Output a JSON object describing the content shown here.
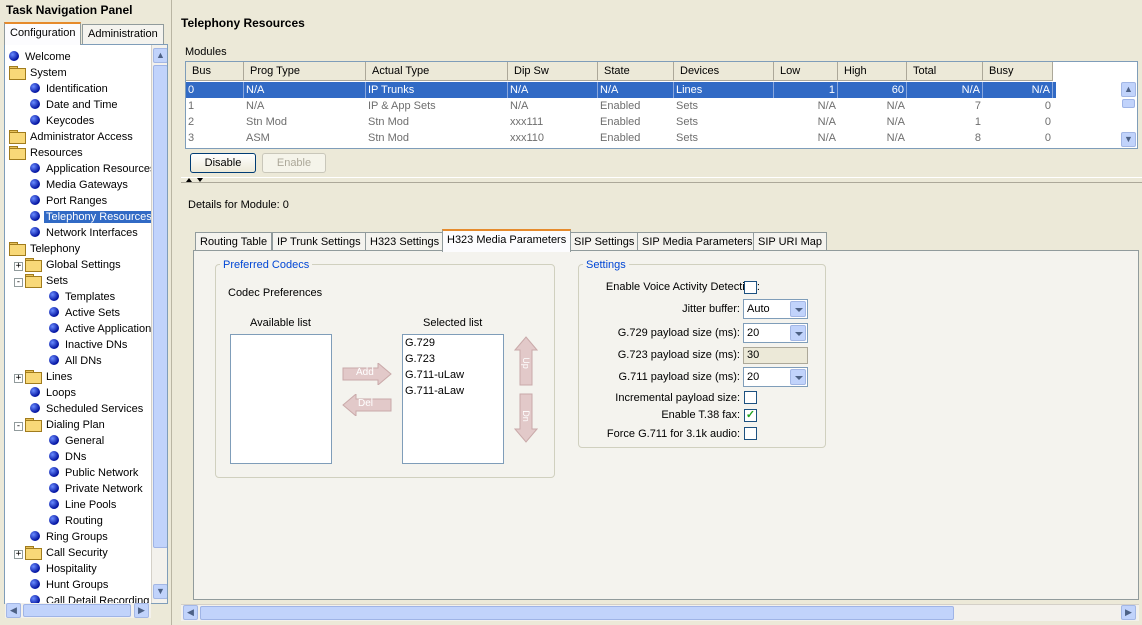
{
  "nav": {
    "title": "Task Navigation Panel",
    "tabs": [
      "Configuration",
      "Administration"
    ],
    "tree": [
      {
        "label": "Welcome",
        "icon": "bullet",
        "indent": 0
      },
      {
        "label": "System",
        "icon": "folder",
        "indent": 0
      },
      {
        "label": "Identification",
        "icon": "bullet",
        "indent": 1
      },
      {
        "label": "Date and Time",
        "icon": "bullet",
        "indent": 1
      },
      {
        "label": "Keycodes",
        "icon": "bullet",
        "indent": 1
      },
      {
        "label": "Administrator Access",
        "icon": "folder",
        "indent": 0
      },
      {
        "label": "Resources",
        "icon": "folder",
        "indent": 0
      },
      {
        "label": "Application Resources",
        "icon": "bullet",
        "indent": 1
      },
      {
        "label": "Media Gateways",
        "icon": "bullet",
        "indent": 1
      },
      {
        "label": "Port Ranges",
        "icon": "bullet",
        "indent": 1
      },
      {
        "label": "Telephony Resources",
        "icon": "bullet",
        "indent": 1,
        "selected": true
      },
      {
        "label": "Network Interfaces",
        "icon": "bullet",
        "indent": 1
      },
      {
        "label": "Telephony",
        "icon": "folder",
        "indent": 0
      },
      {
        "label": "Global Settings",
        "icon": "folder",
        "indent": 1,
        "expander": "+"
      },
      {
        "label": "Sets",
        "icon": "folder",
        "indent": 1,
        "expander": "-"
      },
      {
        "label": "Templates",
        "icon": "bullet",
        "indent": 2
      },
      {
        "label": "Active Sets",
        "icon": "bullet",
        "indent": 2
      },
      {
        "label": "Active Application",
        "icon": "bullet",
        "indent": 2
      },
      {
        "label": "Inactive DNs",
        "icon": "bullet",
        "indent": 2
      },
      {
        "label": "All DNs",
        "icon": "bullet",
        "indent": 2
      },
      {
        "label": "Lines",
        "icon": "folder",
        "indent": 1,
        "expander": "+"
      },
      {
        "label": "Loops",
        "icon": "bullet",
        "indent": 1
      },
      {
        "label": "Scheduled Services",
        "icon": "bullet",
        "indent": 1
      },
      {
        "label": "Dialing Plan",
        "icon": "folder",
        "indent": 1,
        "expander": "-"
      },
      {
        "label": "General",
        "icon": "bullet",
        "indent": 2
      },
      {
        "label": "DNs",
        "icon": "bullet",
        "indent": 2
      },
      {
        "label": "Public Network",
        "icon": "bullet",
        "indent": 2
      },
      {
        "label": "Private Network",
        "icon": "bullet",
        "indent": 2
      },
      {
        "label": "Line Pools",
        "icon": "bullet",
        "indent": 2
      },
      {
        "label": "Routing",
        "icon": "bullet",
        "indent": 2
      },
      {
        "label": "Ring Groups",
        "icon": "bullet",
        "indent": 1
      },
      {
        "label": "Call Security",
        "icon": "folder",
        "indent": 1,
        "expander": "+"
      },
      {
        "label": "Hospitality",
        "icon": "bullet",
        "indent": 1
      },
      {
        "label": "Hunt Groups",
        "icon": "bullet",
        "indent": 1
      },
      {
        "label": "Call Detail Recording",
        "icon": "bullet",
        "indent": 1
      }
    ]
  },
  "main": {
    "title": "Telephony Resources",
    "modules": {
      "label": "Modules",
      "columns": [
        "Bus",
        "Prog Type",
        "Actual Type",
        "Dip Sw",
        "State",
        "Devices",
        "Low",
        "High",
        "Total",
        "Busy"
      ],
      "rows": [
        [
          "0",
          "N/A",
          "IP Trunks",
          "N/A",
          "N/A",
          "Lines",
          "1",
          "60",
          "N/A",
          "N/A"
        ],
        [
          "1",
          "N/A",
          "IP & App Sets",
          "N/A",
          "Enabled",
          "Sets",
          "N/A",
          "N/A",
          "7",
          "0"
        ],
        [
          "2",
          "Stn Mod",
          "Stn Mod",
          "xxx111",
          "Enabled",
          "Sets",
          "N/A",
          "N/A",
          "1",
          "0"
        ],
        [
          "3",
          "ASM",
          "Stn Mod",
          "xxx110",
          "Enabled",
          "Sets",
          "N/A",
          "N/A",
          "8",
          "0"
        ]
      ],
      "buttons": {
        "disable": "Disable",
        "enable": "Enable"
      }
    },
    "details_label": "Details for Module: 0",
    "tabs": [
      "Routing Table",
      "IP Trunk Settings",
      "H323 Settings",
      "H323 Media Parameters",
      "SIP Settings",
      "SIP Media Parameters",
      "SIP URI Map"
    ],
    "active_tab": "H323 Media Parameters",
    "codecs": {
      "group_title": "Preferred Codecs",
      "preferences_label": "Codec Preferences",
      "available_label": "Available list",
      "selected_label": "Selected list",
      "available": [],
      "selected": [
        "G.729",
        "G.723",
        "G.711-uLaw",
        "G.711-aLaw"
      ],
      "add_label": "Add",
      "del_label": "Del",
      "up_label": "Up",
      "down_label": "Dn"
    },
    "settings": {
      "group_title": "Settings",
      "vad_label": "Enable Voice Activity Detection:",
      "vad_checked": false,
      "jitter_label": "Jitter buffer:",
      "jitter_value": "Auto",
      "g729_label": "G.729 payload size (ms):",
      "g729_value": "20",
      "g723_label": "G.723 payload size (ms):",
      "g723_value": "30",
      "g711_label": "G.711 payload size (ms):",
      "g711_value": "20",
      "incremental_label": "Incremental payload size:",
      "incremental_checked": false,
      "t38_label": "Enable T.38 fax:",
      "t38_checked": true,
      "force_label": "Force G.711 for 3.1k audio:",
      "force_checked": false
    }
  }
}
